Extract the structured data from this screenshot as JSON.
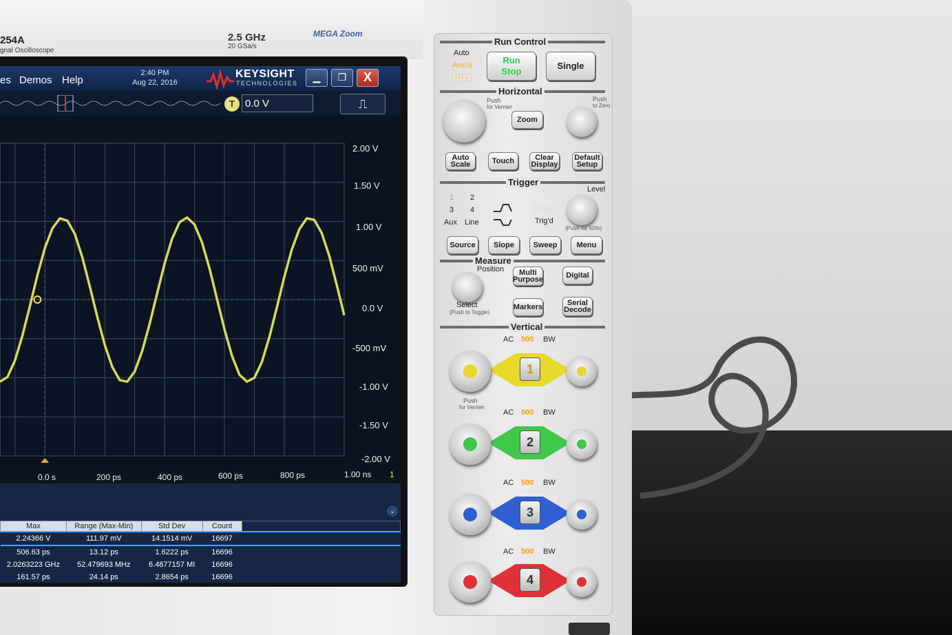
{
  "instrument": {
    "model_fragment": "254A",
    "model_subtitle": "gnal Oscilloscope",
    "bandwidth": "2.5 GHz",
    "sample_rate": "20 GSa/s",
    "megazoom": "MEGA Zoom"
  },
  "menubar": {
    "items": [
      "es",
      "Demos",
      "Help"
    ],
    "time": "2:40 PM",
    "date": "Aug 22, 2016",
    "brand": "KEYSIGHT",
    "brand_sub": "TECHNOLOGIES",
    "close_glyph": "X"
  },
  "toolbar": {
    "trigger_marker": "T",
    "trigger_level": "0.0 V"
  },
  "graph": {
    "y_labels": [
      "2.00 V",
      "1.50 V",
      "1.00 V",
      "500 mV",
      "0.0 V",
      "-500 mV",
      "-1.00 V",
      "-1.50 V",
      "-2.00 V"
    ],
    "x_labels": [
      "0.0 s",
      "200 ps",
      "400 ps",
      "600 ps",
      "800 ps",
      "1.00 ns"
    ],
    "channel_marker": "1",
    "trace_color": "#e8e15a"
  },
  "chart_data": {
    "type": "line",
    "title": "",
    "xlabel": "",
    "ylabel": "",
    "x_unit": "ps",
    "xlim": [
      -150,
      1000
    ],
    "ylim": [
      -2.0,
      2.0
    ],
    "series": [
      {
        "x": [
          -150,
          -125,
          -100,
          -75,
          -50,
          -25,
          0,
          25,
          50,
          75,
          100,
          125,
          150,
          175,
          200,
          225,
          250,
          275,
          300,
          325,
          350,
          375,
          400,
          425,
          450,
          475,
          500,
          525,
          550,
          575,
          600,
          625,
          650,
          675,
          700,
          725,
          750,
          775,
          800,
          825,
          850,
          875,
          900,
          925,
          950,
          975,
          1000
        ],
        "y": [
          -1.05,
          -0.99,
          -0.78,
          -0.46,
          -0.08,
          0.31,
          0.66,
          0.91,
          1.04,
          1.01,
          0.84,
          0.54,
          0.17,
          -0.22,
          -0.58,
          -0.86,
          -1.03,
          -1.05,
          -0.92,
          -0.66,
          -0.31,
          0.08,
          0.46,
          0.78,
          0.99,
          1.05,
          0.96,
          0.73,
          0.4,
          0.01,
          -0.38,
          -0.72,
          -0.96,
          -1.05,
          -1.0,
          -0.8,
          -0.48,
          -0.1,
          0.29,
          0.64,
          0.9,
          1.04,
          1.02,
          0.85,
          0.56,
          0.19,
          -0.2
        ]
      }
    ],
    "grid": true
  },
  "measurements": {
    "headers": [
      "Max",
      "Range (Max-Min)",
      "Std Dev",
      "Count"
    ],
    "rows": [
      [
        "2.24366 V",
        "111.97 mV",
        "14.1514 mV",
        "16697"
      ],
      [
        "506.63 ps",
        "13.12 ps",
        "1.6222 ps",
        "16696"
      ],
      [
        "2.0263223 GHz",
        "52.479693 MHz",
        "6.4877157 MI",
        "16696"
      ],
      [
        "161.57 ps",
        "24.14 ps",
        "2.8654 ps",
        "16696"
      ]
    ]
  },
  "panel": {
    "run_control": {
      "title": "Run Control",
      "auto": "Auto",
      "armd": "Arm'd",
      "trigd": "Trig'd",
      "run": "Run",
      "stop": "Stop",
      "single": "Single"
    },
    "horizontal": {
      "title": "Horizontal",
      "push_vernier": "Push",
      "for_vernier": "for Vernier",
      "push_zero": "Push",
      "to_zero": "to Zero",
      "zoom": "Zoom",
      "auto_scale": "Auto Scale",
      "touch": "Touch",
      "clear_display": "Clear Display",
      "default_setup": "Default Setup"
    },
    "trigger": {
      "title": "Trigger",
      "level": "Level",
      "src1": "1",
      "src2": "2",
      "src3": "3",
      "src4": "4",
      "aux": "Aux",
      "line": "Line",
      "auto": "Auto",
      "trigd": "Trig'd",
      "push50": "(Push for 50%)",
      "source": "Source",
      "slope": "Slope",
      "sweep": "Sweep",
      "menu": "Menu"
    },
    "measure": {
      "title": "Measure",
      "position": "Position",
      "multi_purpose": "Multi Purpose",
      "digital": "Digital",
      "select": "Select",
      "push_toggle": "(Push to Toggle)",
      "markers": "Markers",
      "serial_decode": "Serial Decode"
    },
    "vertical": {
      "title": "Vertical",
      "ac": "AC",
      "bw_num": "500",
      "bw": "BW",
      "push": "Push",
      "for_vernier": "for Vernier",
      "channels": [
        "1",
        "2",
        "3",
        "4"
      ],
      "colors": [
        "#e8d82a",
        "#3fc84a",
        "#2f5fd0",
        "#e03038"
      ]
    }
  }
}
